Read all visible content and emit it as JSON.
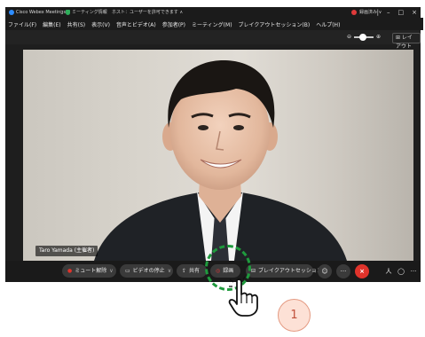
{
  "titlebar": {
    "app_title": "Cisco Webex Meetings",
    "separator": "|",
    "meeting_info": "ミーティング情報",
    "host_info": "ホスト：ユーザーを許可できます ∧",
    "recording": "録画済み ∨",
    "min": "|",
    "minimize": "–",
    "maximize": "□",
    "close": "×"
  },
  "menubar": {
    "items": [
      "ファイル(F)",
      "編集(E)",
      "共有(S)",
      "表示(V)",
      "音声とビデオ(A)",
      "参加者(P)",
      "ミーティング(M)",
      "ブレイクアウトセッション(B)",
      "ヘルプ(H)"
    ]
  },
  "subbar": {
    "zoom_minus": "⊖",
    "zoom_plus": "⊕",
    "zoom_level": 0.3,
    "layout_label": "⊞ レイアウト"
  },
  "video": {
    "participant_name": "Taro Yamada (主催者)"
  },
  "toolbar": {
    "mute_label": "ミュート解除",
    "video_label": "ビデオの停止",
    "share_label": "共有",
    "record_label": "録画",
    "breakout_label": "ブレイクアウトセッション",
    "more_label": "···",
    "end_label": "×",
    "participants_label": "人",
    "chat_label": "◯",
    "menu_label": "···"
  },
  "annotation": {
    "step_number": "1",
    "highlight_color": "#1f9a3d",
    "step_color": "#fde1d6"
  },
  "colors": {
    "accent": "#2d8cff",
    "end_call": "#e0332b",
    "record_dot": "#e03a3a"
  }
}
